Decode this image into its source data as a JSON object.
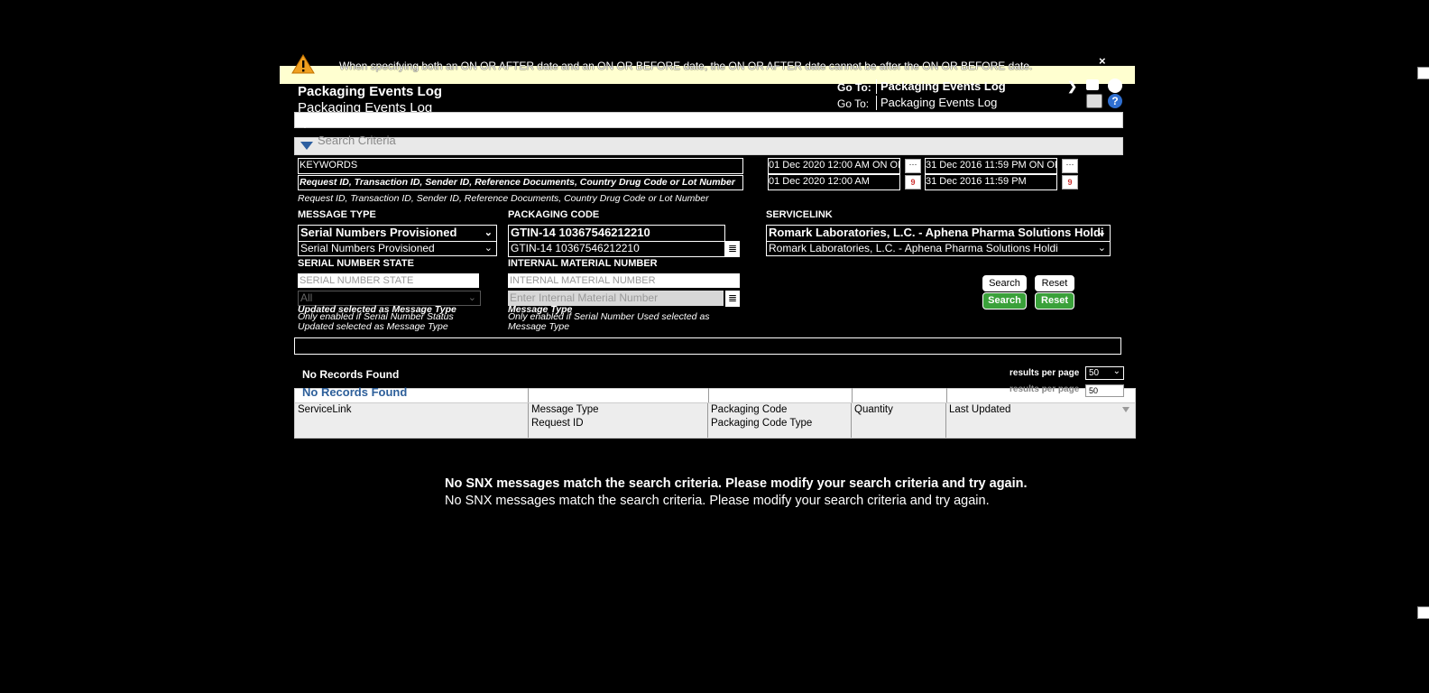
{
  "warning": {
    "text": "When specifying both an ON OR AFTER date and an ON OR BEFORE date, the ON OR AFTER date cannot be after the ON OR BEFORE date.",
    "close": "×"
  },
  "header": {
    "title": "Packaging Events Log",
    "goto_label": "Go To:",
    "goto_value": "Packaging Events Log"
  },
  "search_criteria": {
    "label": "Search Criteria",
    "keywords_placeholder": "KEYWORDS",
    "keywords_hint": "Request ID, Transaction ID, Sender ID, Reference Documents, Country Drug Code or Lot Number",
    "date_after_label": "ON OR AFTER",
    "date_after_value": "01 Dec 2020 12:00 AM",
    "date_before_label": "ON OR BEFORE",
    "date_before_value": "31 Dec 2016 11:59 PM",
    "message_type_label": "MESSAGE TYPE",
    "message_type_value": "Serial Numbers Provisioned",
    "packaging_code_label": "PACKAGING CODE",
    "packaging_code_value": "GTIN-14 10367546212210",
    "servicelink_label": "SERVICELINK",
    "servicelink_value": "Romark Laboratories, L.C. - Aphena Pharma Solutions Holdi",
    "serial_state_label": "SERIAL NUMBER STATE",
    "serial_state_placeholder": "SERIAL NUMBER STATE",
    "serial_state_value": "All",
    "serial_state_hint_1": "Only enabled if Serial Number Status",
    "serial_state_hint_2": "Updated selected as Message Type",
    "internal_material_label": "INTERNAL MATERIAL NUMBER",
    "internal_material_placeholder": "INTERNAL MATERIAL NUMBER",
    "internal_material_input_placeholder": "Enter Internal Material Number",
    "internal_material_hint_1": "Only enabled if Serial Number Used selected as",
    "internal_material_hint_2": "Message Type",
    "search_button": "Search",
    "reset_button": "Reset"
  },
  "results": {
    "status": "No Records Found",
    "per_page_label": "results per page",
    "per_page_value": "50",
    "columns": [
      {
        "line1": "ServiceLink",
        "line2": ""
      },
      {
        "line1": "Message Type",
        "line2": "Request ID"
      },
      {
        "line1": "Packaging Code",
        "line2": "Packaging Code Type"
      },
      {
        "line1": "Quantity",
        "line2": ""
      },
      {
        "line1": "Last Updated",
        "line2": ""
      }
    ],
    "empty_message": "No SNX messages match the search criteria. Please modify your search criteria and try again."
  },
  "icons": {
    "warning": "warning-triangle-icon",
    "print": "print-icon",
    "help": "help-icon",
    "calendar": "calendar-icon",
    "list": "list-icon",
    "expand": "triangle-down-icon"
  }
}
